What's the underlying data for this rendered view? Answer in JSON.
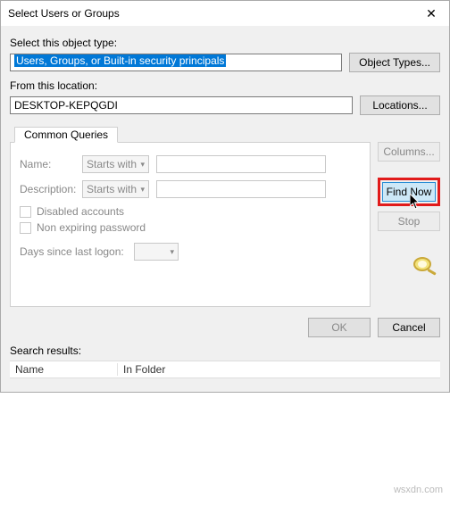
{
  "window": {
    "title": "Select Users or Groups"
  },
  "objectType": {
    "label": "Select this object type:",
    "value": "Users, Groups, or Built-in security principals",
    "button": "Object Types..."
  },
  "location": {
    "label": "From this location:",
    "value": "DESKTOP-KEPQGDI",
    "button": "Locations..."
  },
  "tab": {
    "label": "Common Queries"
  },
  "query": {
    "nameLabel": "Name:",
    "descLabel": "Description:",
    "startsWith": "Starts with",
    "disabled": "Disabled accounts",
    "nonexp": "Non expiring password",
    "daysLabel": "Days since last logon:"
  },
  "right": {
    "columns": "Columns...",
    "findNow": "Find Now",
    "stop": "Stop"
  },
  "footer": {
    "ok": "OK",
    "cancel": "Cancel",
    "searchResults": "Search results:"
  },
  "columns": {
    "name": "Name",
    "inFolder": "In Folder"
  },
  "watermark": "wsxdn.com"
}
